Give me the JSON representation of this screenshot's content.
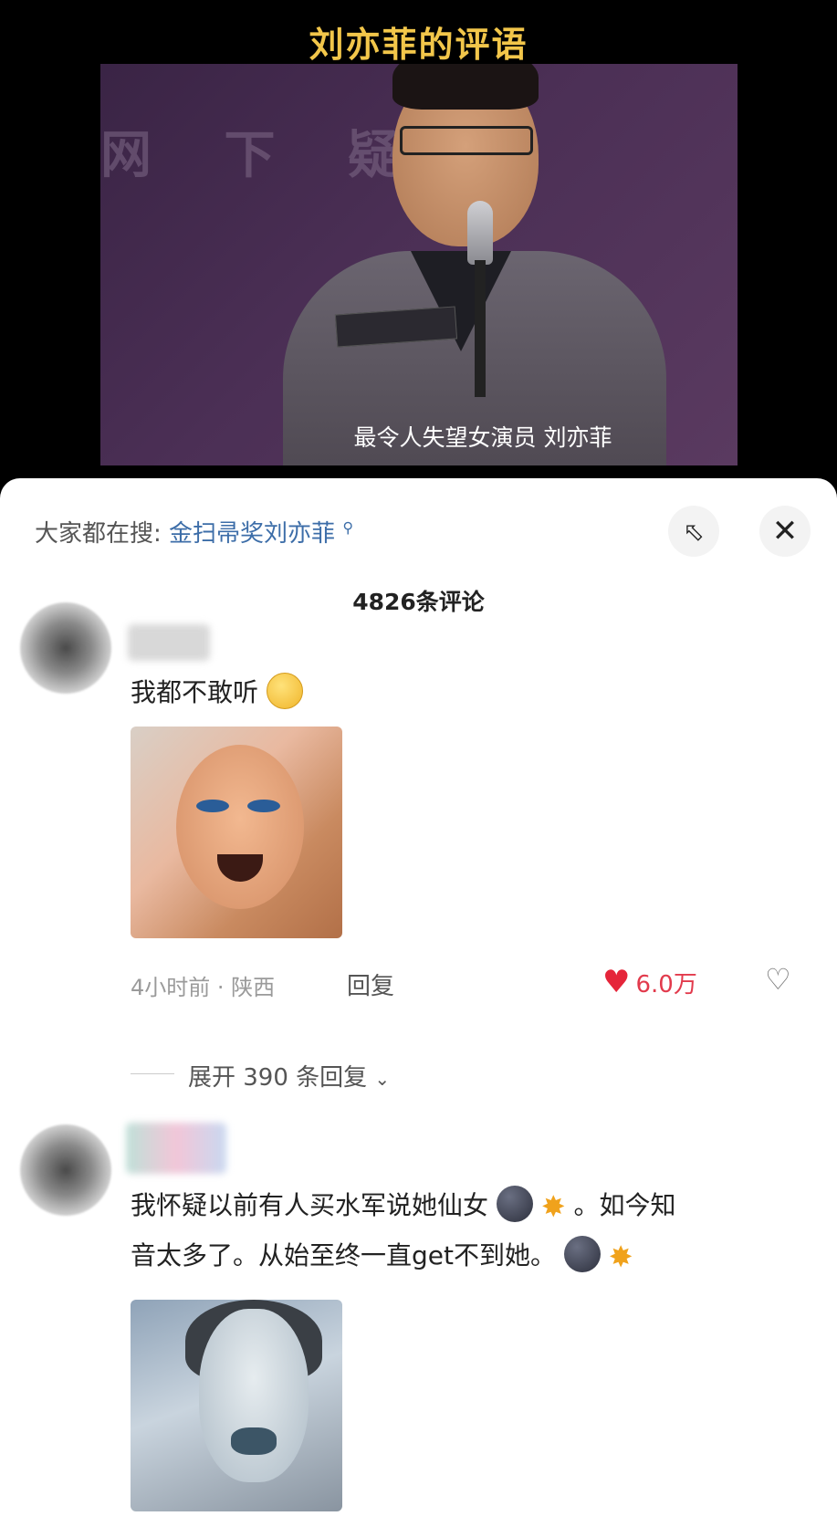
{
  "video": {
    "title": "刘亦菲的评语",
    "bg_text": "网 下 疑",
    "subtitle": "最令人失望女演员 刘亦菲"
  },
  "sheet": {
    "search_prefix": "大家都在搜:",
    "search_link": "金扫帚奖刘亦菲",
    "search_icon": "search-icon",
    "expand_icon": "expand-icon",
    "close_icon": "close-icon",
    "comment_count": "4826条评论"
  },
  "comments": [
    {
      "text": "我都不敢听",
      "emoji": "dizzy-face-emoji",
      "meta": "4小时前 · 陕西",
      "reply_label": "回复",
      "likes": "6.0万",
      "expand_label": "展开 390 条回复",
      "expand_icon": "chevron-down-icon"
    },
    {
      "text_line1": "我怀疑以前有人买水军说她仙女",
      "text_line1_end": "。如今知",
      "text_line2": "音太多了。从始至终一直get不到她。",
      "emoji": "dark-face-emoji",
      "emoji2": "pray-emoji"
    }
  ],
  "colors": {
    "title_yellow": "#F2C64A",
    "link_blue": "#3C6DA8",
    "like_red": "#E5253A"
  }
}
